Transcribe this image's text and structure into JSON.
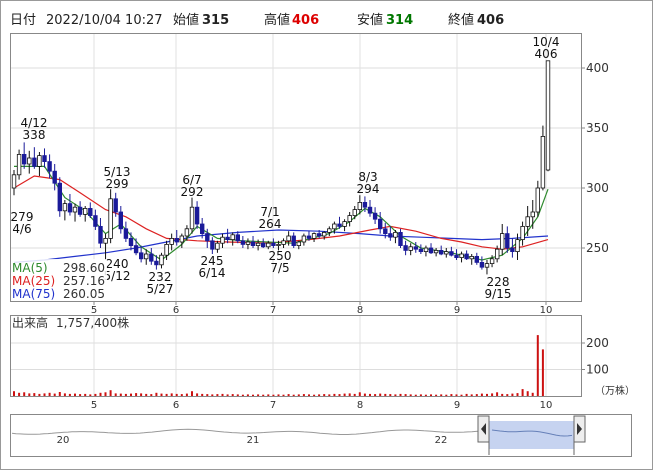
{
  "header": {
    "date_label": "日付",
    "datetime": "2022/10/04 10:27",
    "open_label": "始値",
    "open": "315",
    "high_label": "高値",
    "high": "406",
    "low_label": "安値",
    "low": "314",
    "close_label": "終値",
    "close": "406"
  },
  "colors": {
    "up": "#111111",
    "down": "#1a1a99",
    "ma5": "#2e8b2e",
    "ma25": "#dd2222",
    "ma75": "#2233cc",
    "volume": "#cc1111",
    "high": "#dd0000",
    "low": "#007700",
    "frame": "#888888",
    "navigator_fill": "#b8c8ec"
  },
  "legend": [
    {
      "label": "MA(5)",
      "value": "298.60",
      "color": "#2e8b2e"
    },
    {
      "label": "MA(25)",
      "value": "257.16",
      "color": "#dd2222"
    },
    {
      "label": "MA(75)",
      "value": "260.05",
      "color": "#2233cc"
    }
  ],
  "volume_panel": {
    "label": "出来高",
    "value": "1,757,400株",
    "unit": "（万株）"
  },
  "chart_data": {
    "type": "candlestick",
    "price_axis": {
      "ticks": [
        250,
        300,
        350,
        400
      ]
    },
    "month_ticks": [
      "5",
      "6",
      "7",
      "8",
      "9",
      "10"
    ],
    "volume_axis": {
      "ticks": [
        100,
        200
      ]
    },
    "navigator_ticks": [
      "20",
      "21",
      "22"
    ],
    "annotations": [
      {
        "date": "4/6",
        "value": "279",
        "label": "279\n4/6"
      },
      {
        "date": "4/12",
        "value": "338",
        "label": "4/12\n338"
      },
      {
        "date": "5/12",
        "value": "240",
        "label": "240\n5/12"
      },
      {
        "date": "5/13",
        "value": "299",
        "label": "5/13\n299"
      },
      {
        "date": "5/27",
        "value": "232",
        "label": "232\n5/27"
      },
      {
        "date": "6/7",
        "value": "292",
        "label": "6/7\n292"
      },
      {
        "date": "6/14",
        "value": "245",
        "label": "245\n6/14"
      },
      {
        "date": "7/1",
        "value": "264",
        "label": "7/1\n264"
      },
      {
        "date": "7/5",
        "value": "250",
        "label": "250\n7/5"
      },
      {
        "date": "8/3",
        "value": "294",
        "label": "8/3\n294"
      },
      {
        "date": "9/15",
        "value": "228",
        "label": "228\n9/15"
      },
      {
        "date": "10/4",
        "value": "406",
        "label": "10/4\n406"
      }
    ],
    "candles": [
      [
        300,
        315,
        294,
        311
      ],
      [
        311,
        332,
        307,
        328
      ],
      [
        328,
        338,
        316,
        320
      ],
      [
        320,
        331,
        312,
        325
      ],
      [
        325,
        334,
        316,
        318
      ],
      [
        318,
        330,
        310,
        327
      ],
      [
        327,
        333,
        317,
        322
      ],
      [
        322,
        328,
        308,
        314
      ],
      [
        314,
        320,
        298,
        304
      ],
      [
        304,
        309,
        276,
        281
      ],
      [
        281,
        290,
        273,
        287
      ],
      [
        287,
        295,
        277,
        280
      ],
      [
        280,
        287,
        272,
        284
      ],
      [
        284,
        289,
        276,
        278
      ],
      [
        278,
        285,
        272,
        283
      ],
      [
        283,
        288,
        275,
        277
      ],
      [
        277,
        282,
        265,
        268
      ],
      [
        268,
        275,
        250,
        254
      ],
      [
        254,
        262,
        240,
        258
      ],
      [
        258,
        299,
        254,
        291
      ],
      [
        291,
        296,
        276,
        280
      ],
      [
        280,
        285,
        262,
        266
      ],
      [
        266,
        272,
        255,
        258
      ],
      [
        258,
        263,
        248,
        252
      ],
      [
        252,
        258,
        244,
        246
      ],
      [
        246,
        252,
        238,
        241
      ],
      [
        241,
        249,
        236,
        245
      ],
      [
        245,
        250,
        236,
        239
      ],
      [
        239,
        244,
        232,
        236
      ],
      [
        236,
        246,
        233,
        244
      ],
      [
        244,
        256,
        240,
        253
      ],
      [
        253,
        262,
        248,
        258
      ],
      [
        258,
        265,
        252,
        255
      ],
      [
        255,
        262,
        250,
        260
      ],
      [
        260,
        269,
        256,
        266
      ],
      [
        266,
        292,
        262,
        284
      ],
      [
        284,
        289,
        266,
        270
      ],
      [
        270,
        275,
        258,
        262
      ],
      [
        262,
        266,
        250,
        256
      ],
      [
        256,
        259,
        245,
        249
      ],
      [
        249,
        256,
        246,
        254
      ],
      [
        254,
        262,
        250,
        259
      ],
      [
        259,
        266,
        254,
        257
      ],
      [
        257,
        263,
        252,
        261
      ],
      [
        261,
        264,
        254,
        256
      ],
      [
        256,
        260,
        250,
        253
      ],
      [
        253,
        258,
        249,
        255
      ],
      [
        255,
        260,
        250,
        252
      ],
      [
        252,
        257,
        248,
        254
      ],
      [
        254,
        258,
        250,
        251
      ],
      [
        251,
        256,
        249,
        254
      ],
      [
        254,
        258,
        250,
        252
      ],
      [
        252,
        256,
        248,
        253
      ],
      [
        253,
        258,
        250,
        256
      ],
      [
        256,
        264,
        252,
        260
      ],
      [
        260,
        263,
        250,
        252
      ],
      [
        252,
        256,
        249,
        255
      ],
      [
        255,
        262,
        252,
        260
      ],
      [
        260,
        264,
        256,
        258
      ],
      [
        258,
        263,
        255,
        262
      ],
      [
        262,
        265,
        258,
        260
      ],
      [
        260,
        264,
        257,
        263
      ],
      [
        263,
        268,
        260,
        266
      ],
      [
        266,
        272,
        262,
        270
      ],
      [
        270,
        276,
        266,
        268
      ],
      [
        268,
        274,
        264,
        272
      ],
      [
        272,
        280,
        268,
        277
      ],
      [
        277,
        285,
        274,
        282
      ],
      [
        282,
        294,
        278,
        288
      ],
      [
        288,
        293,
        280,
        284
      ],
      [
        284,
        290,
        276,
        279
      ],
      [
        279,
        284,
        270,
        274
      ],
      [
        274,
        280,
        262,
        266
      ],
      [
        266,
        271,
        258,
        262
      ],
      [
        262,
        268,
        256,
        259
      ],
      [
        259,
        265,
        254,
        263
      ],
      [
        263,
        266,
        250,
        252
      ],
      [
        252,
        256,
        244,
        248
      ],
      [
        248,
        254,
        244,
        251
      ],
      [
        251,
        255,
        246,
        249
      ],
      [
        249,
        253,
        245,
        247
      ],
      [
        247,
        252,
        243,
        250
      ],
      [
        250,
        254,
        245,
        246
      ],
      [
        246,
        250,
        243,
        248
      ],
      [
        248,
        252,
        244,
        245
      ],
      [
        245,
        250,
        242,
        247
      ],
      [
        247,
        251,
        243,
        244
      ],
      [
        244,
        249,
        240,
        242
      ],
      [
        242,
        247,
        238,
        245
      ],
      [
        245,
        248,
        240,
        241
      ],
      [
        241,
        245,
        236,
        243
      ],
      [
        243,
        246,
        236,
        238
      ],
      [
        238,
        243,
        232,
        234
      ],
      [
        234,
        240,
        228,
        237
      ],
      [
        237,
        244,
        234,
        241
      ],
      [
        241,
        252,
        238,
        249
      ],
      [
        249,
        270,
        244,
        262
      ],
      [
        262,
        268,
        246,
        250
      ],
      [
        250,
        258,
        242,
        247
      ],
      [
        247,
        262,
        240,
        257
      ],
      [
        257,
        272,
        252,
        268
      ],
      [
        268,
        285,
        260,
        276
      ],
      [
        276,
        290,
        266,
        280
      ],
      [
        280,
        306,
        276,
        300
      ],
      [
        300,
        352,
        298,
        343
      ],
      [
        315,
        406,
        314,
        406
      ]
    ],
    "ma5": [
      [
        0,
        318
      ],
      [
        6,
        318
      ],
      [
        10,
        292
      ],
      [
        14,
        281
      ],
      [
        18,
        262
      ],
      [
        21,
        270
      ],
      [
        25,
        251
      ],
      [
        29,
        240
      ],
      [
        33,
        253
      ],
      [
        36,
        268
      ],
      [
        40,
        258
      ],
      [
        45,
        256
      ],
      [
        55,
        254
      ],
      [
        62,
        262
      ],
      [
        66,
        272
      ],
      [
        69,
        283
      ],
      [
        72,
        276
      ],
      [
        76,
        260
      ],
      [
        80,
        250
      ],
      [
        86,
        246
      ],
      [
        92,
        240
      ],
      [
        96,
        244
      ],
      [
        100,
        258
      ],
      [
        103,
        276
      ],
      [
        105,
        299
      ]
    ],
    "ma25": [
      [
        0,
        300
      ],
      [
        4,
        310
      ],
      [
        9,
        307
      ],
      [
        13,
        296
      ],
      [
        18,
        282
      ],
      [
        22,
        276
      ],
      [
        26,
        266
      ],
      [
        30,
        258
      ],
      [
        36,
        256
      ],
      [
        42,
        255
      ],
      [
        50,
        254
      ],
      [
        58,
        257
      ],
      [
        64,
        260
      ],
      [
        70,
        265
      ],
      [
        74,
        268
      ],
      [
        79,
        264
      ],
      [
        84,
        258
      ],
      [
        88,
        255
      ],
      [
        92,
        251
      ],
      [
        96,
        249
      ],
      [
        100,
        251
      ],
      [
        105,
        257
      ]
    ],
    "ma75": [
      [
        0,
        238
      ],
      [
        6,
        240
      ],
      [
        12,
        243
      ],
      [
        18,
        246
      ],
      [
        24,
        250
      ],
      [
        30,
        255
      ],
      [
        36,
        260
      ],
      [
        44,
        263
      ],
      [
        52,
        265
      ],
      [
        60,
        264
      ],
      [
        68,
        262
      ],
      [
        74,
        260
      ],
      [
        80,
        259
      ],
      [
        86,
        258
      ],
      [
        92,
        257
      ],
      [
        98,
        258
      ],
      [
        105,
        260
      ]
    ],
    "volume": [
      18,
      12,
      14,
      10,
      11,
      8,
      10,
      12,
      9,
      15,
      10,
      8,
      9,
      7,
      8,
      6,
      8,
      12,
      14,
      22,
      10,
      9,
      8,
      9,
      11,
      10,
      8,
      7,
      12,
      9,
      8,
      10,
      8,
      7,
      9,
      18,
      10,
      8,
      7,
      6,
      7,
      8,
      6,
      7,
      6,
      5,
      6,
      5,
      6,
      5,
      6,
      5,
      6,
      5,
      7,
      5,
      6,
      7,
      6,
      5,
      6,
      7,
      6,
      8,
      7,
      9,
      10,
      8,
      14,
      9,
      8,
      7,
      9,
      8,
      7,
      6,
      8,
      7,
      6,
      5,
      6,
      5,
      6,
      5,
      6,
      5,
      7,
      6,
      5,
      8,
      6,
      7,
      9,
      8,
      10,
      14,
      8,
      7,
      9,
      11,
      26,
      18,
      12,
      230,
      176
    ]
  }
}
